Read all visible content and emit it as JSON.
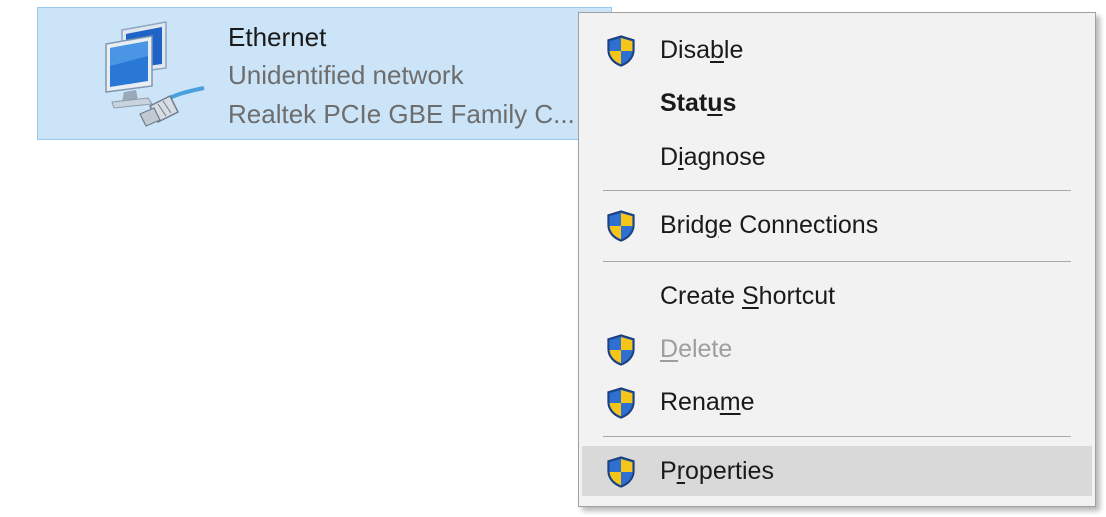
{
  "adapter": {
    "name": "Ethernet",
    "status": "Unidentified network",
    "device": "Realtek PCIe GBE Family C...",
    "icon": "network-adapter-icon",
    "selected_bg": "#cce4f7"
  },
  "menu": {
    "items": [
      {
        "pre": "Disa",
        "key": "b",
        "post": "le",
        "shield": true,
        "bold": false,
        "disabled": false
      },
      {
        "pre": "Stat",
        "key": "u",
        "post": "s",
        "shield": false,
        "bold": true,
        "disabled": false
      },
      {
        "pre": "D",
        "key": "i",
        "post": "agnose",
        "shield": false,
        "bold": false,
        "disabled": false
      },
      {
        "pre": "Brid",
        "key": "g",
        "post": "e Connections",
        "shield": true,
        "bold": false,
        "disabled": false
      },
      {
        "pre": "Create ",
        "key": "S",
        "post": "hortcut",
        "shield": false,
        "bold": false,
        "disabled": false
      },
      {
        "pre": "",
        "key": "D",
        "post": "elete",
        "shield": true,
        "bold": false,
        "disabled": true
      },
      {
        "pre": "Rena",
        "key": "m",
        "post": "e",
        "shield": true,
        "bold": false,
        "disabled": false
      },
      {
        "pre": "P",
        "key": "r",
        "post": "operties",
        "shield": true,
        "bold": false,
        "disabled": false,
        "highlighted": true
      }
    ],
    "shield_icon": "uac-shield-icon",
    "colors": {
      "background": "#f2f2f2",
      "highlight": "#d9d9d9",
      "disabled_text": "#9e9e9e",
      "shield_blue": "#2b5fb4",
      "shield_yellow": "#f2c21b"
    }
  }
}
